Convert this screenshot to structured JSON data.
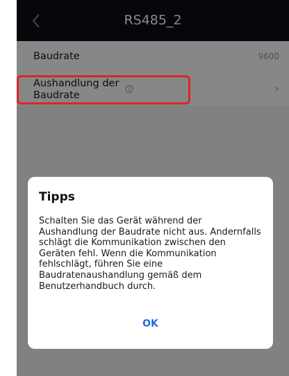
{
  "header": {
    "title": "RS485_2",
    "back_icon": "chevron-left-icon"
  },
  "settings": {
    "items": [
      {
        "label": "Baudrate",
        "value": "9600"
      },
      {
        "label": "Aushandlung der Baudrate",
        "info_icon": "info-circle-icon",
        "chevron": "›"
      }
    ]
  },
  "highlight_color": "#d9262b",
  "dialog": {
    "title": "Tipps",
    "message": "Schalten Sie das Gerät während der Aushandlung der Baudrate nicht aus. Andernfalls schlägt die Kommunikation zwischen den Geräten fehl. Wenn die Kommunikation fehlschlägt, führen Sie eine Baudratenaushandlung gemäß dem Benutzerhandbuch durch.",
    "ok_label": "OK",
    "ok_color": "#1e6fd9"
  }
}
